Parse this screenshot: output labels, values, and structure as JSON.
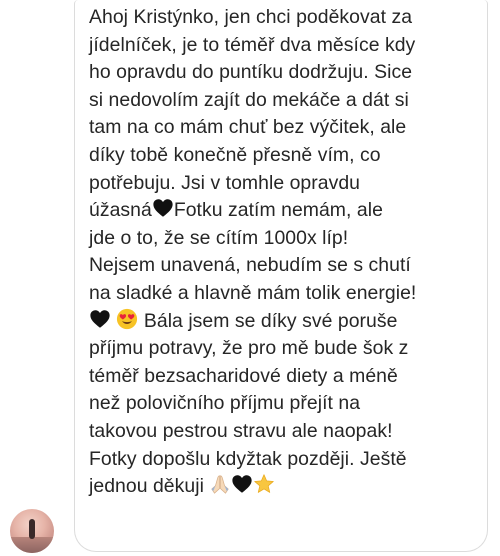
{
  "message": {
    "lines": [
      "Ahoj Kristýnko, jen chci poděkovat za",
      "jídelníček, je to téměř dva měsíce kdy",
      "ho opravdu do puntíku dodržuju. Sice",
      "si nedovolím zajít do mekáče a dát si",
      "tam na co mám chuť bez výčitek, ale",
      "díky tobě konečně přesně vím, co",
      "potřebuju. Jsi v tomhle opravdu",
      "úžasná",
      "Fotku zatím nemám, ale",
      "jde o to, že se cítím 1000x líp!",
      "Nejsem unavená, nebudím se s chutí",
      "na sladké a hlavně mám tolik energie!",
      "Bála jsem se díky své poruše",
      "příjmu potravy, že pro mě bude šok z",
      "téměř bezsacharidové diety a méně",
      "než polovičního příjmu přejít na",
      "takovou pestrou stravu ale naopak!",
      "Fotky dopošlu kdyžtak později. Ještě",
      "jednou děkuji"
    ]
  },
  "icons": {
    "black_heart": "black-heart-icon",
    "heart_eyes": "heart-eyes-icon",
    "praying_hands": "praying-hands-icon",
    "star": "star-icon"
  },
  "colors": {
    "text": "#262626",
    "bubble_border": "#dcdcdc",
    "heart": "#111111",
    "heart_eyes_face": "#f7c325",
    "star": "#f8c640"
  }
}
